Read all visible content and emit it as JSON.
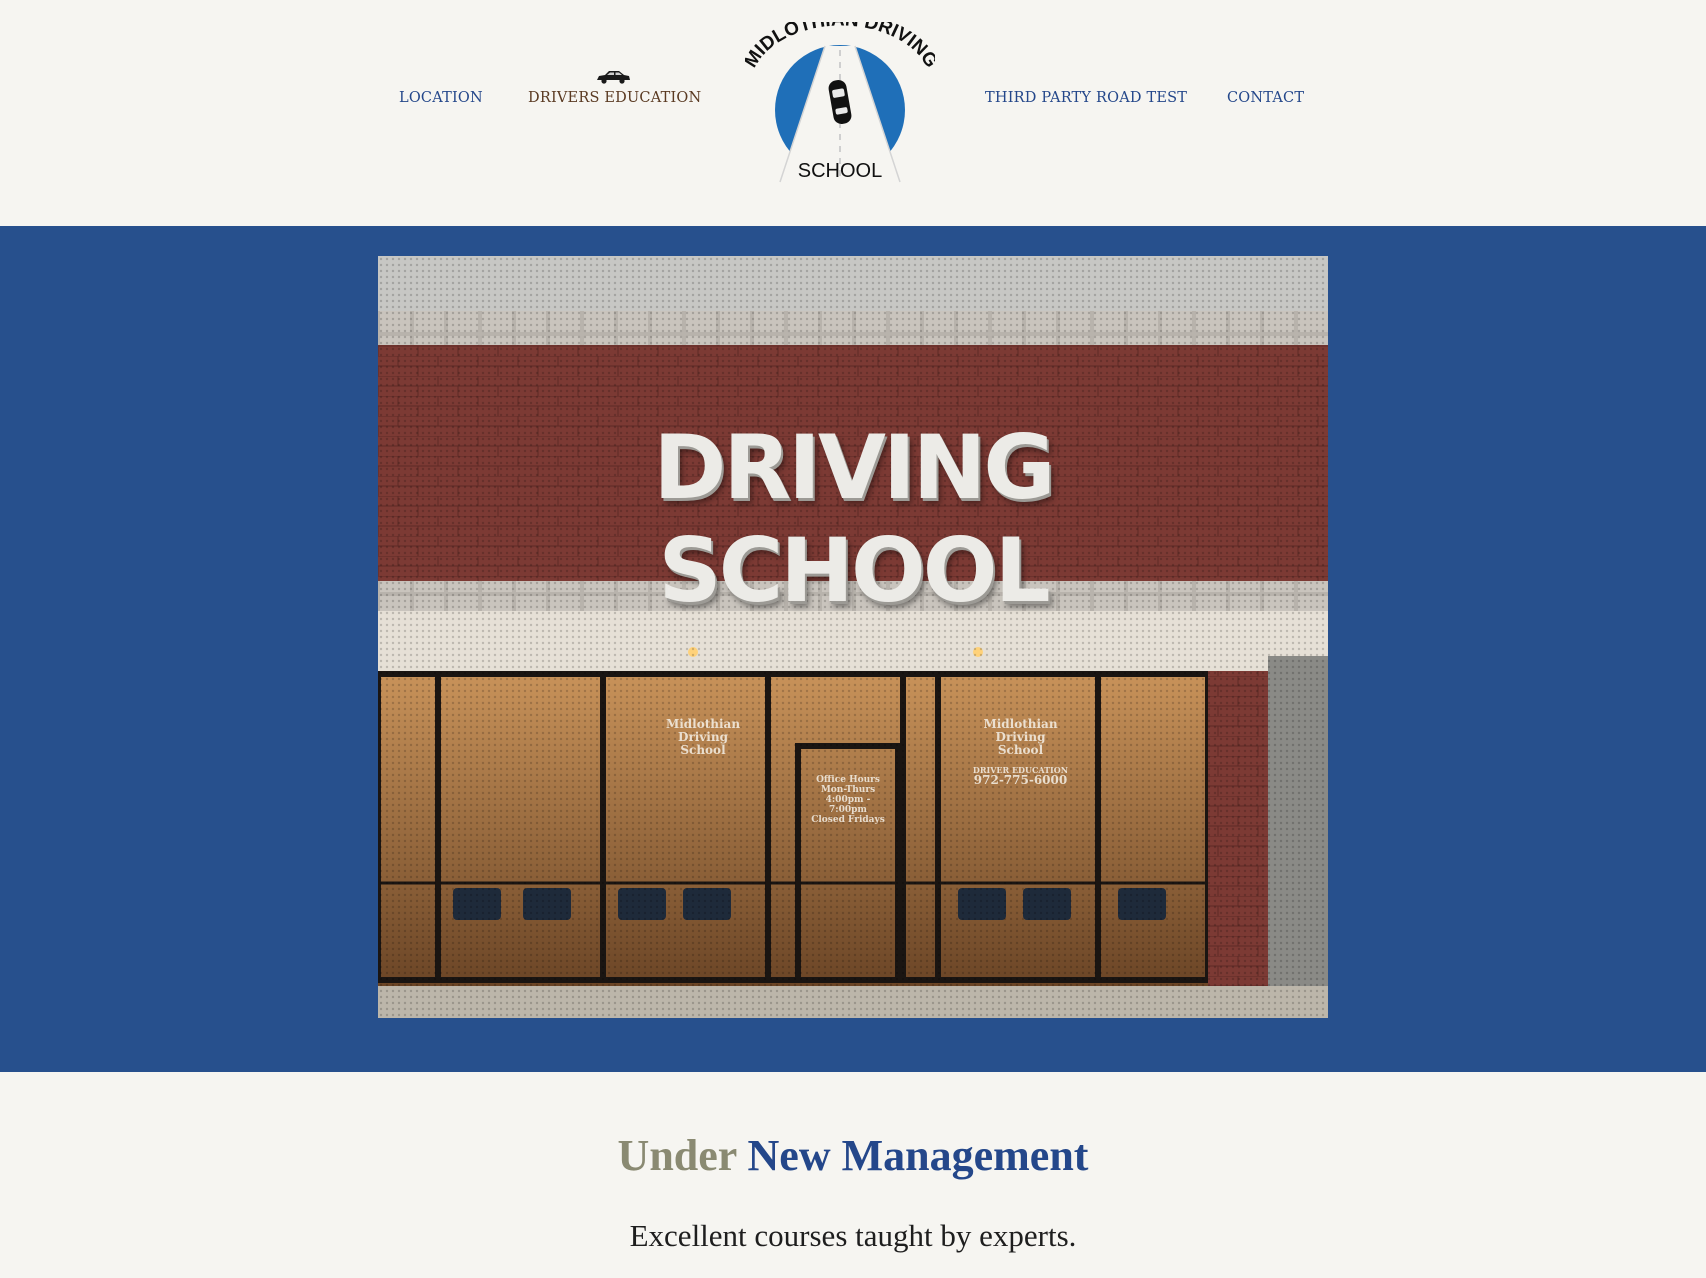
{
  "nav": {
    "location": "LOCATION",
    "drivers_education": "DRIVERS EDUCATION",
    "third_party_road_test": "THIRD PARTY ROAD TEST",
    "contact": "CONTACT"
  },
  "logo": {
    "top_text": "MIDLOTHIAN DRIVING",
    "bottom_text": "SCHOOL"
  },
  "hero": {
    "sign": "DRIVING SCHOOL",
    "window_left": [
      "Midlothian",
      "Driving",
      "School"
    ],
    "window_right": [
      "Midlothian",
      "Driving",
      "School"
    ],
    "window_right_caption": "DRIVER EDUCATION",
    "window_right_phone": "972-775-6000",
    "door_text": [
      "Office Hours",
      "Mon-Thurs",
      "4:00pm - 7:00pm",
      "Closed Fridays"
    ]
  },
  "headline": {
    "part1": "Under",
    "part2": "New Management"
  },
  "subheadline": "Excellent courses taught by experts.",
  "colors": {
    "brand_blue": "#27508d",
    "nav_blue": "#24478a",
    "nav_active": "#5a3a22",
    "background": "#f6f5f1"
  }
}
